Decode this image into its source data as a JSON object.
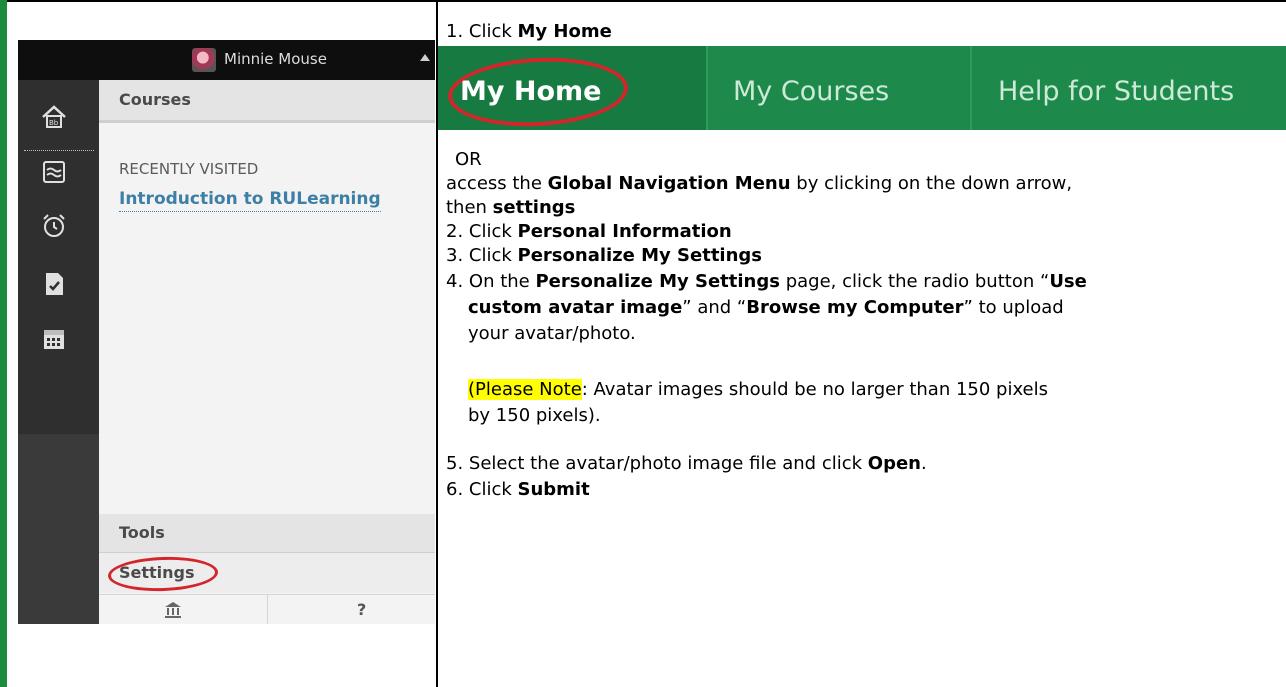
{
  "lms": {
    "user_name": "Minnie Mouse",
    "courses_label": "Courses",
    "recently_visited": "RECENTLY VISITED",
    "course_link": "Introduction to RULearning",
    "tools_label": "Tools",
    "settings_label": "Settings",
    "help_glyph": "?",
    "icons": [
      "bb-home-icon",
      "activity-stream-icon",
      "alarm-clock-icon",
      "grades-icon",
      "calendar-icon",
      "institution-icon"
    ]
  },
  "nav": {
    "my_home": "My Home",
    "my_courses": "My Courses",
    "help_for_students": "Help for Students",
    "highlight_color": "#d2262b",
    "bar_color": "#1d8a4b"
  },
  "instructions": {
    "step1_prefix": "1. Click ",
    "step1_bold": "My Home",
    "or": "OR",
    "global_a": "access the ",
    "global_bold": "Global Navigation Menu",
    "global_b": " by clicking on the down arrow,",
    "global_c": "then ",
    "global_c_bold": "settings",
    "step2_prefix": "2.  Click ",
    "step2_bold": "Personal Information",
    "step3_prefix": "3.  Click ",
    "step3_bold": "Personalize My Settings",
    "step4_a": "4.  On the ",
    "step4_bold1": "Personalize My Settings",
    "step4_b": " page, click the radio button “",
    "step4_bold2": "Use",
    "step4_bold3": "custom avatar image",
    "step4_c": "” and “",
    "step4_bold4": "Browse my Computer",
    "step4_d": "” to upload",
    "step4_e": "your avatar/photo.",
    "note_highlight": "(Please Note",
    "note_a": ": Avatar images should be no larger than 150 pixels",
    "note_b": "by 150 pixels).",
    "step5_a": "5.  Select the avatar/photo image file and click ",
    "step5_bold": "Open",
    "step5_end": ".",
    "step6_prefix": "6.  Click ",
    "step6_bold": "Submit"
  }
}
